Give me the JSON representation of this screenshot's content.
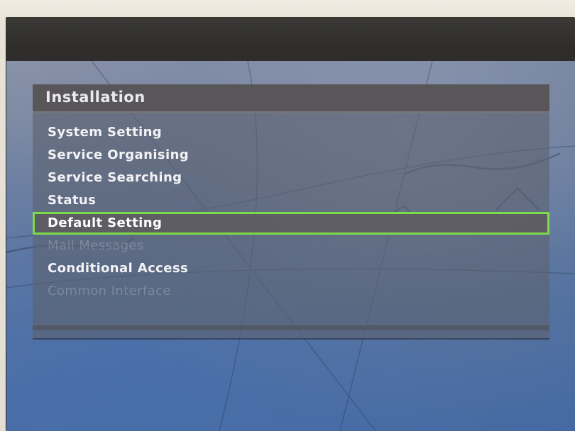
{
  "panel": {
    "title": "Installation"
  },
  "menu": {
    "items": [
      {
        "label": "System Setting",
        "state": "enabled"
      },
      {
        "label": "Service Organising",
        "state": "enabled"
      },
      {
        "label": "Service Searching",
        "state": "enabled"
      },
      {
        "label": "Status",
        "state": "enabled"
      },
      {
        "label": "Default Setting",
        "state": "selected"
      },
      {
        "label": "Mail Messages",
        "state": "disabled"
      },
      {
        "label": "Conditional Access",
        "state": "enabled"
      },
      {
        "label": "Common Interface",
        "state": "disabled"
      }
    ]
  },
  "colors": {
    "selection_outline": "#7ddb4a",
    "title_bar": "#585456",
    "text": "#f3f3f6",
    "screen_background": "#4f6f9f"
  }
}
